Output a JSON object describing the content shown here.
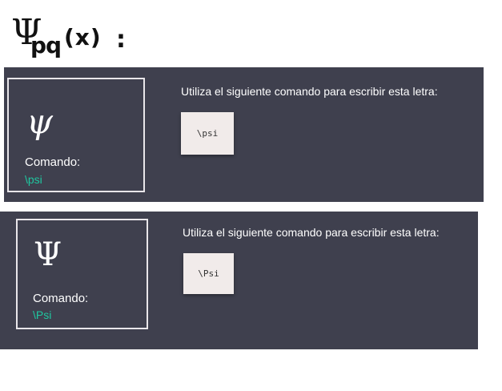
{
  "handwritten_note": {
    "symbol": "Ψ",
    "subscript": "pq",
    "argument": "(x)",
    "colon": ":"
  },
  "panels": [
    {
      "glyph": "ψ",
      "command_label": "Comando:",
      "command_value": "\\psi",
      "instruction": "Utiliza el siguiente comando para escribir esta letra:",
      "code": "\\psi"
    },
    {
      "glyph": "Ψ",
      "command_label": "Comando:",
      "command_value": "\\Psi",
      "instruction": "Utiliza el siguiente comando para escribir esta letra:",
      "code": "\\Psi"
    }
  ],
  "colors": {
    "panel_background": "#3f404e",
    "command_accent": "#1fc7a0",
    "code_box_background": "#f1ebea"
  }
}
